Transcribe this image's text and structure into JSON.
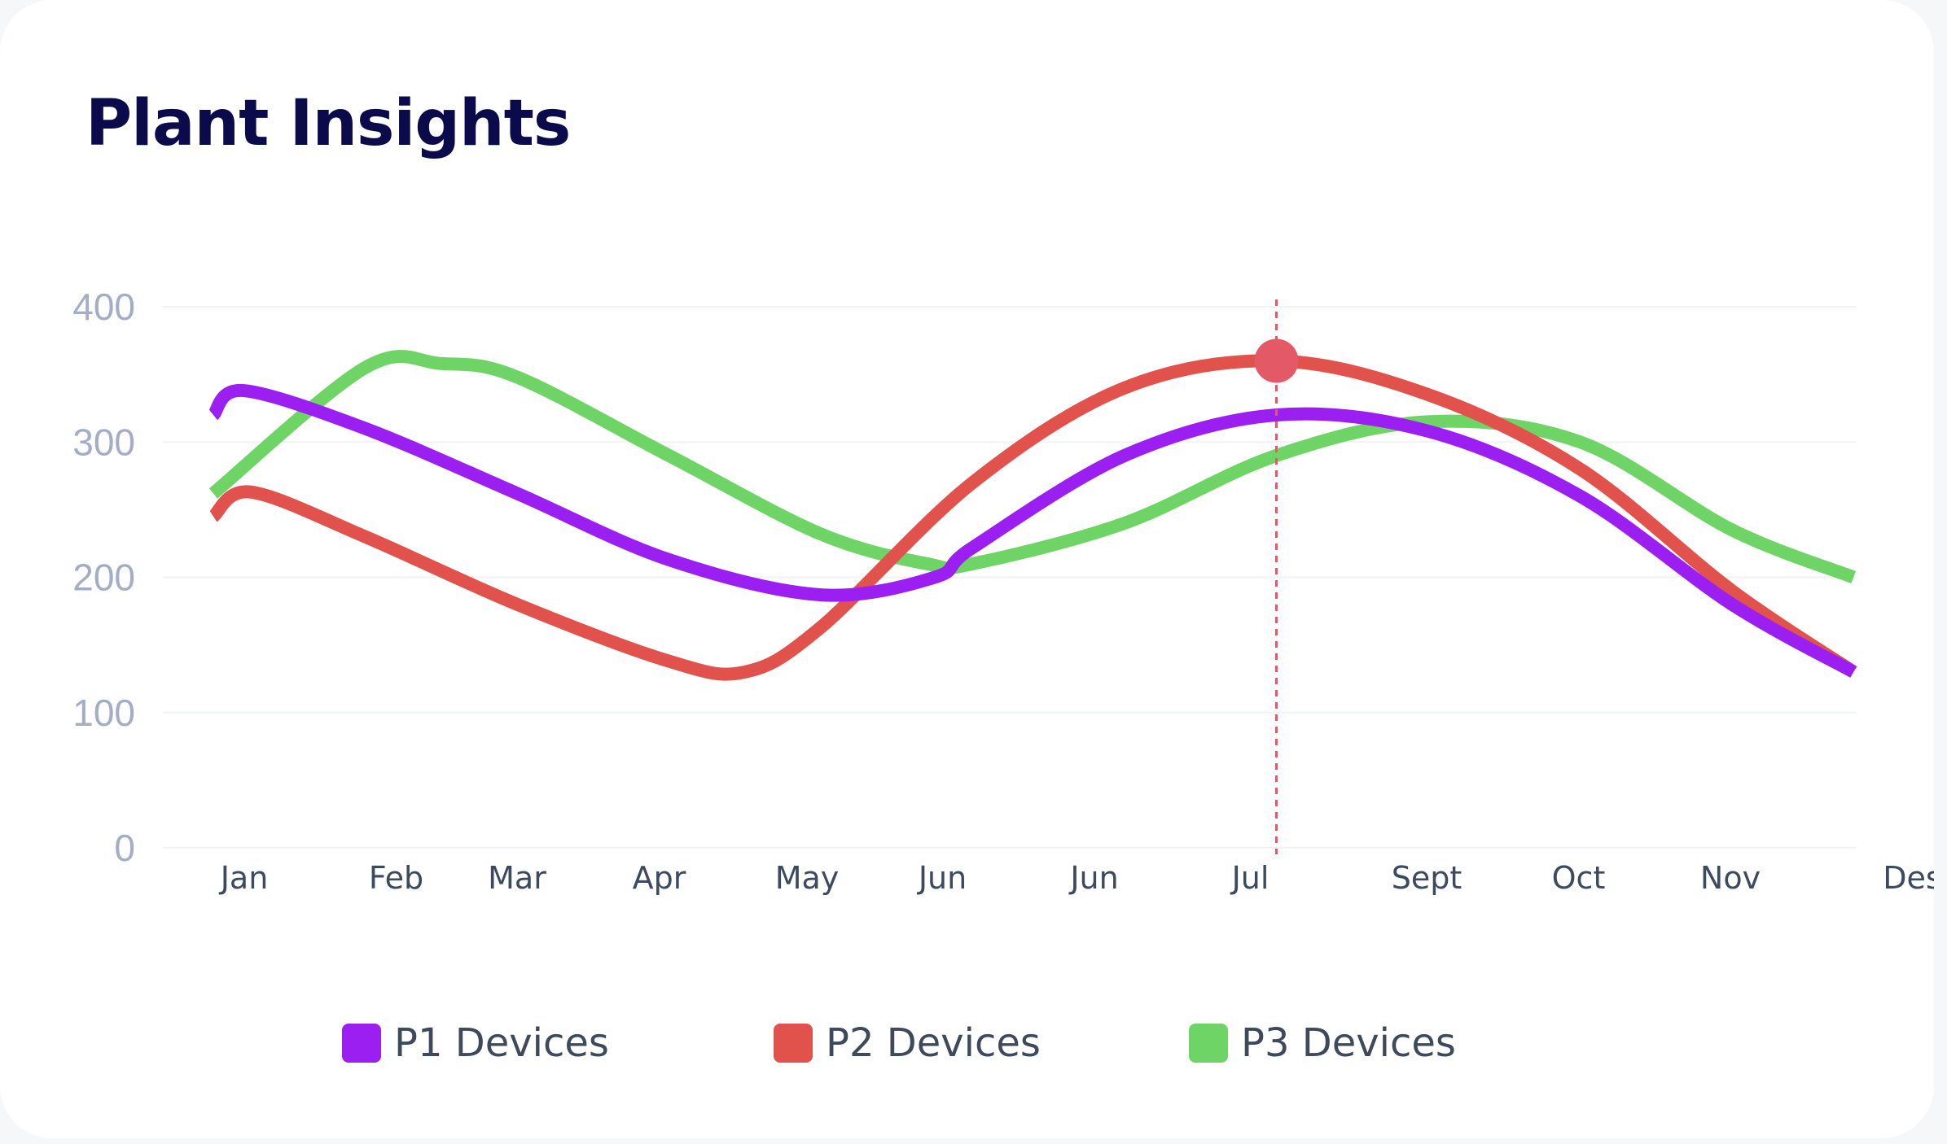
{
  "header": {
    "title": "Plant Insights"
  },
  "colors": {
    "p1": "#9a1ff0",
    "p2": "#e0524b",
    "p3": "#6ed466",
    "marker": "#e35a66",
    "grid": "#f0f2f5",
    "y_tick": "#a3aec6",
    "x_tick": "#3b4a5e"
  },
  "chart_data": {
    "type": "line",
    "title": "Plant Insights",
    "xlabel": "",
    "ylabel": "",
    "categories": [
      "Jan",
      "Feb",
      "Mar",
      "Apr",
      "May",
      "Jun",
      "Jun",
      "Jul",
      "Sept",
      "Oct",
      "Nov",
      "Des"
    ],
    "y_ticks": [
      0,
      100,
      200,
      300,
      400
    ],
    "ylim": [
      0,
      400
    ],
    "grid": true,
    "smooth": true,
    "legend_position": "bottom",
    "series": [
      {
        "name": "P1 Devices",
        "color_key": "p1",
        "x": [
          0,
          0.2,
          1,
          2,
          3,
          4,
          4.75,
          5,
          6,
          7,
          8,
          9,
          10,
          10.8
        ],
        "values": [
          320,
          338,
          310,
          262,
          213,
          187,
          200,
          222,
          290,
          320,
          308,
          260,
          180,
          130
        ]
      },
      {
        "name": "P2 Devices",
        "color_key": "p2",
        "x": [
          0,
          0.25,
          1,
          2,
          3,
          3.5,
          4,
          5,
          6,
          7,
          8,
          9,
          10,
          10.8
        ],
        "values": [
          245,
          263,
          230,
          180,
          138,
          130,
          163,
          270,
          340,
          360,
          335,
          280,
          190,
          130
        ]
      },
      {
        "name": "P3 Devices",
        "color_key": "p3",
        "x": [
          0,
          1,
          1.5,
          2,
          3,
          4,
          4.7,
          5,
          6,
          7,
          8,
          9,
          10,
          10.8
        ],
        "values": [
          262,
          355,
          358,
          348,
          290,
          232,
          210,
          210,
          240,
          290,
          315,
          300,
          235,
          200
        ]
      }
    ],
    "highlight": {
      "category": "Jul",
      "series": "P2 Devices",
      "x": 7,
      "value": 360
    }
  },
  "legend": {
    "items": [
      "P1 Devices",
      "P2 Devices",
      "P3 Devices"
    ]
  }
}
